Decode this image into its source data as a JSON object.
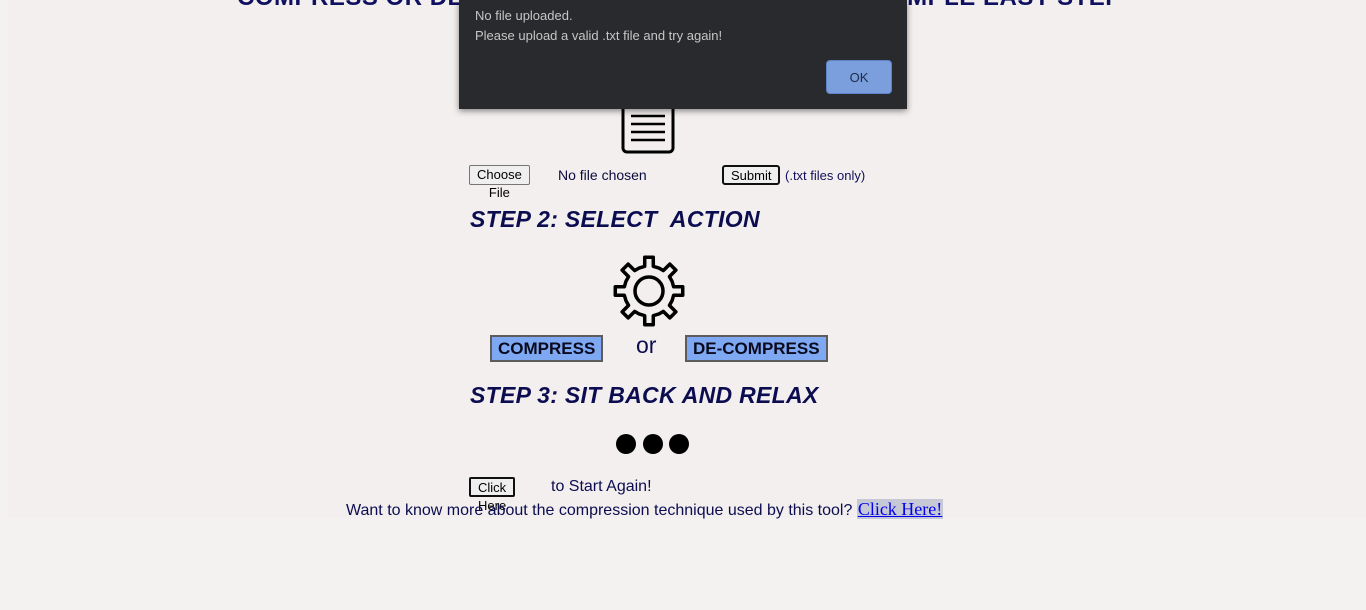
{
  "header": {
    "title": "COMPRESS OR DE-COMPRESS YOUR FILE IN THREE SIMPLE EASY STEPS!!"
  },
  "step1": {
    "icon": "document-icon",
    "choose_label": "Choose File",
    "file_status": "No file chosen",
    "submit_label": "Submit",
    "hint": "(.txt files only)"
  },
  "step2": {
    "title": "STEP 2: SELECT  ACTION",
    "icon": "gear-icon",
    "compress_label": "COMPRESS",
    "or_label": "or",
    "decompress_label": "DE-COMPRESS"
  },
  "step3": {
    "title": "STEP 3: SIT BACK AND RELAX",
    "icon": "three-dots-icon"
  },
  "footer": {
    "restart_button": "Click Here",
    "restart_text": "to Start Again!",
    "learn_text": "Want to know more about the compression technique used by this tool?",
    "learn_link": "Click Here!"
  },
  "dialog": {
    "line1": "No file uploaded.",
    "line2": "Please upload a valid .txt file and try again!",
    "ok_label": "OK"
  },
  "colors": {
    "page_background": "#f3efee",
    "heading": "#0b0d50",
    "action_button": "#7fa8f3",
    "dialog_background": "#292a2d",
    "dialog_button": "#7b9fdc"
  }
}
